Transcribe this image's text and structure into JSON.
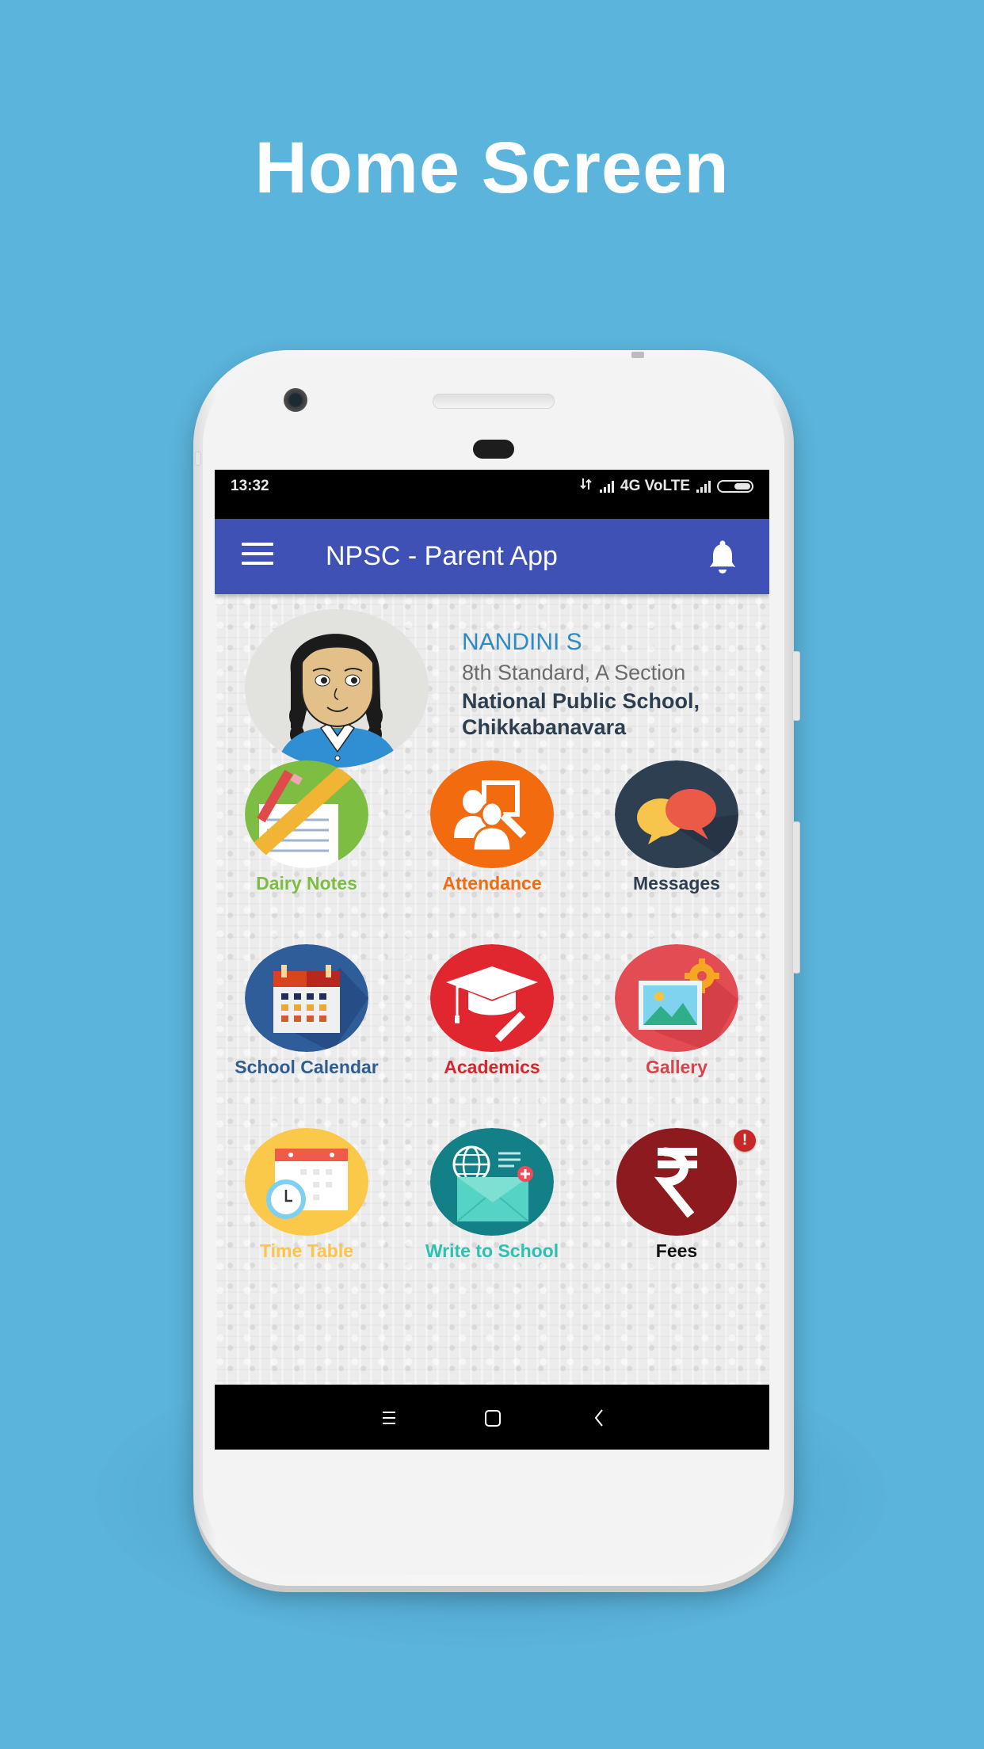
{
  "promo": {
    "title": "Home Screen"
  },
  "status_bar": {
    "time": "13:32",
    "data_icon": "data-transfer-arrows-icon",
    "network_label": "4G VoLTE",
    "signal_icon": "signal-bars-icon",
    "battery_icon": "battery-icon"
  },
  "app_bar": {
    "menu_icon": "hamburger-menu-icon",
    "title": "NPSC - Parent App",
    "notification_icon": "bell-icon"
  },
  "profile": {
    "name": "NANDINI S",
    "class_section": "8th Standard, A Section",
    "school_line1": "National Public School,",
    "school_line2": "Chikkabanavara",
    "avatar_icon": "student-avatar-illustration"
  },
  "tiles": [
    {
      "label": "Dairy Notes",
      "icon": "notebook-pencil-ruler-icon",
      "circle_color": "#7cbd42",
      "label_color": "#7cbd42"
    },
    {
      "label": "Attendance",
      "icon": "users-board-icon",
      "circle_color": "#f26b0f",
      "label_color": "#f26b0f"
    },
    {
      "label": "Messages",
      "icon": "chat-bubbles-icon",
      "circle_color": "#2f3f52",
      "label_color": "#2f3f52"
    },
    {
      "label": "School Calendar",
      "icon": "calendar-icon",
      "circle_color": "#2f5d9a",
      "label_color": "#2f5d8f"
    },
    {
      "label": "Academics",
      "icon": "graduation-cap-icon",
      "circle_color": "#e0262f",
      "label_color": "#d3262e"
    },
    {
      "label": "Gallery",
      "icon": "gallery-image-gear-icon",
      "circle_color": "#e44c54",
      "label_color": "#d9434c"
    },
    {
      "label": "Time Table",
      "icon": "timetable-clock-icon",
      "circle_color": "#fbc94a",
      "label_color": "#f9c54a"
    },
    {
      "label": "Write to School",
      "icon": "mail-globe-icon",
      "circle_color": "#137f86",
      "label_color": "#2cc1b0"
    },
    {
      "label": "Fees",
      "icon": "rupee-icon",
      "circle_color": "#8c1a1f",
      "label_color": "#111111",
      "badge": "!"
    }
  ],
  "nav_bar": {
    "recents_icon": "recents-menu-icon",
    "home_icon": "home-square-icon",
    "back_icon": "back-chevron-icon"
  },
  "colors": {
    "background": "#5bb4dc",
    "app_bar": "#3f51b5",
    "alert_badge": "#c62828"
  }
}
